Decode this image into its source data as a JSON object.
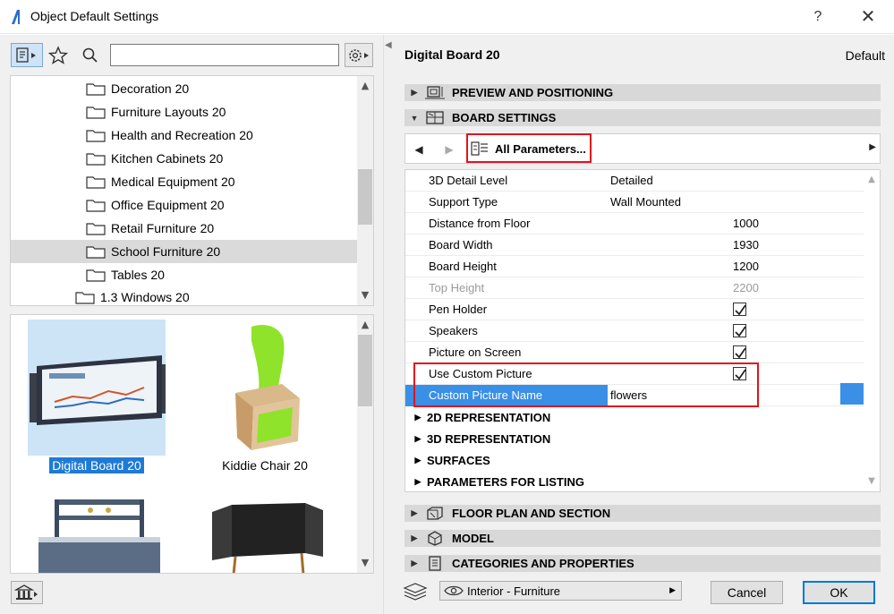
{
  "window": {
    "title": "Object Default Settings",
    "help": "?",
    "close": "✕"
  },
  "left": {
    "search_value": "",
    "tree": [
      {
        "label": "Decoration 20",
        "selected": false
      },
      {
        "label": "Furniture Layouts 20",
        "selected": false
      },
      {
        "label": "Health and Recreation 20",
        "selected": false
      },
      {
        "label": "Kitchen Cabinets 20",
        "selected": false
      },
      {
        "label": "Medical Equipment 20",
        "selected": false
      },
      {
        "label": "Office Equipment 20",
        "selected": false
      },
      {
        "label": "Retail Furniture 20",
        "selected": false
      },
      {
        "label": "School Furniture 20",
        "selected": true
      },
      {
        "label": "Tables 20",
        "selected": false
      },
      {
        "label": "1.3 Windows 20",
        "selected": false
      }
    ],
    "thumbnails": [
      {
        "label": "Digital Board 20",
        "selected": true
      },
      {
        "label": "Kiddie Chair 20",
        "selected": false
      },
      {
        "label": "",
        "selected": false
      },
      {
        "label": "",
        "selected": false
      }
    ]
  },
  "right": {
    "object_name": "Digital Board 20",
    "default_label": "Default",
    "sections_top": [
      {
        "label": "PREVIEW AND POSITIONING",
        "expanded": false
      },
      {
        "label": "BOARD SETTINGS",
        "expanded": true
      }
    ],
    "nav": {
      "page_label": "All Parameters..."
    },
    "params": [
      {
        "name": "3D Detail Level",
        "value": "Detailed",
        "kind": "text"
      },
      {
        "name": "Support Type",
        "value": "Wall Mounted",
        "kind": "text"
      },
      {
        "name": "Distance from Floor",
        "value": "1000",
        "kind": "number"
      },
      {
        "name": "Board Width",
        "value": "1930",
        "kind": "number"
      },
      {
        "name": "Board Height",
        "value": "1200",
        "kind": "number"
      },
      {
        "name": "Top Height",
        "value": "2200",
        "kind": "number",
        "disabled": true
      },
      {
        "name": "Pen Holder",
        "value": "true",
        "kind": "check"
      },
      {
        "name": "Speakers",
        "value": "true",
        "kind": "check"
      },
      {
        "name": "Picture on Screen",
        "value": "true",
        "kind": "check"
      },
      {
        "name": "Use Custom Picture",
        "value": "true",
        "kind": "check"
      },
      {
        "name": "Custom Picture Name",
        "value": "flowers",
        "kind": "text",
        "selected": true
      }
    ],
    "groups": [
      "2D REPRESENTATION",
      "3D REPRESENTATION",
      "SURFACES",
      "PARAMETERS FOR LISTING"
    ],
    "sections_bottom": [
      {
        "label": "FLOOR PLAN AND SECTION"
      },
      {
        "label": "MODEL"
      },
      {
        "label": "CATEGORIES AND PROPERTIES"
      }
    ],
    "layer": "Interior - Furniture",
    "cancel_label": "Cancel",
    "ok_label": "OK"
  },
  "colors": {
    "accent": "#3a8fe6",
    "highlight": "#e0141e",
    "selection_label": "#1f7ad6"
  }
}
